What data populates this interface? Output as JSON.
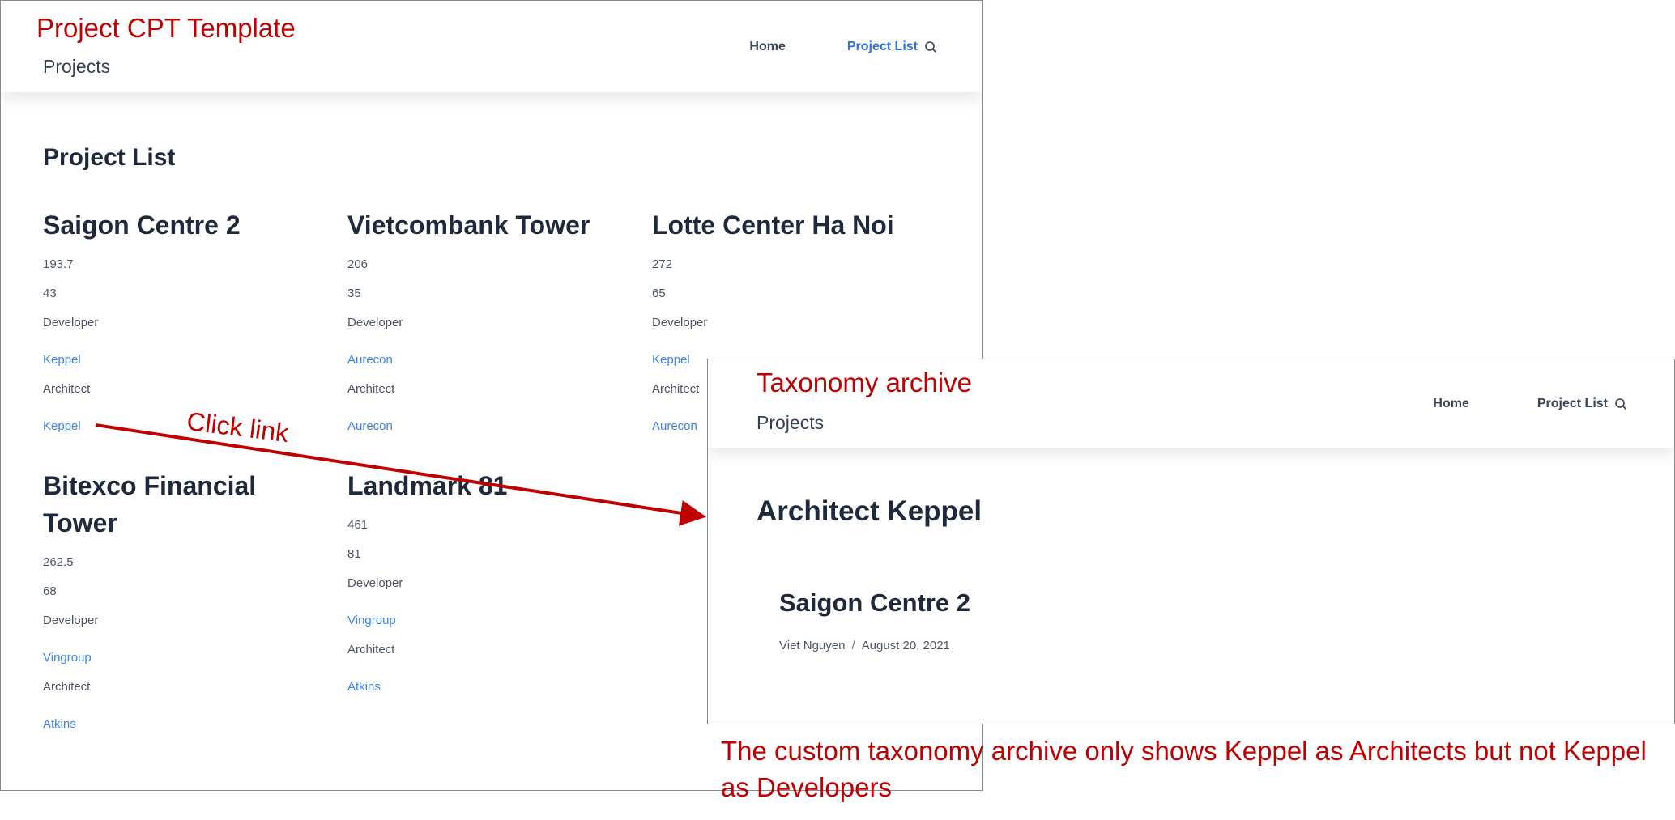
{
  "annotations": {
    "left_title": "Project CPT Template",
    "right_title": "Taxonomy archive",
    "click_label": "Click link",
    "note": "The custom taxonomy archive only shows Keppel as Architects but not Keppel as Developers"
  },
  "left_window": {
    "site_title": "Projects",
    "nav": [
      {
        "label": "Home"
      },
      {
        "label": "Project List"
      }
    ],
    "heading": "Project List",
    "projects": [
      {
        "title": "Saigon Centre 2",
        "height": "193.7",
        "floors": "43",
        "developer_label": "Developer",
        "developer": "Keppel",
        "architect_label": "Architect",
        "architect": "Keppel"
      },
      {
        "title": "Vietcombank Tower",
        "height": "206",
        "floors": "35",
        "developer_label": "Developer",
        "developer": "Aurecon",
        "architect_label": "Architect",
        "architect": "Aurecon"
      },
      {
        "title": "Lotte Center Ha Noi",
        "height": "272",
        "floors": "65",
        "developer_label": "Developer",
        "developer": "Keppel",
        "architect_label": "Architect",
        "architect": "Aurecon"
      },
      {
        "title": "Bitexco Financial Tower",
        "height": "262.5",
        "floors": "68",
        "developer_label": "Developer",
        "developer": "Vingroup",
        "architect_label": "Architect",
        "architect": "Atkins"
      },
      {
        "title": "Landmark 81",
        "height": "461",
        "floors": "81",
        "developer_label": "Developer",
        "developer": "Vingroup",
        "architect_label": "Architect",
        "architect": "Atkins"
      }
    ]
  },
  "right_window": {
    "site_title": "Projects",
    "nav": [
      {
        "label": "Home"
      },
      {
        "label": "Project List"
      }
    ],
    "heading": "Architect Keppel",
    "post": {
      "title": "Saigon Centre 2",
      "author": "Viet Nguyen",
      "separator": "/",
      "date": "August 20, 2021"
    }
  },
  "colors": {
    "annotation": "#c00000",
    "link": "#3b82f6",
    "nav_current": "#2f6fe0",
    "heading": "#1e293b"
  },
  "icons": [
    "search-icon",
    "arrow-icon"
  ]
}
